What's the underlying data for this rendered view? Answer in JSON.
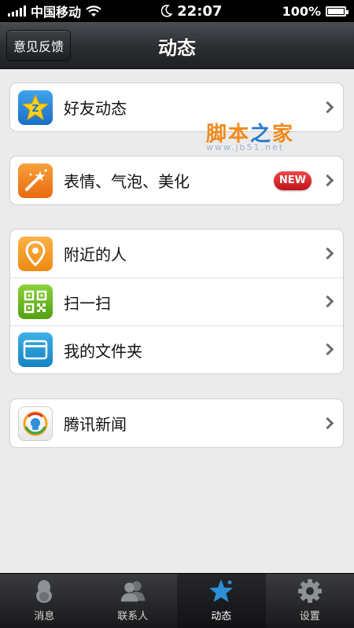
{
  "status_bar": {
    "carrier": "中国移动",
    "time": "22:07",
    "battery": "100%",
    "battery_level": 1.0
  },
  "nav": {
    "title": "动态",
    "feedback_button": "意见反馈"
  },
  "groups": [
    [
      {
        "label": "好友动态",
        "icon": "qzone-star-icon"
      }
    ],
    [
      {
        "label": "表情、气泡、美化",
        "icon": "magic-wand-icon",
        "badge": "NEW"
      }
    ],
    [
      {
        "label": "附近的人",
        "icon": "location-pin-icon"
      },
      {
        "label": "扫一扫",
        "icon": "qr-code-icon"
      },
      {
        "label": "我的文件夹",
        "icon": "folder-icon"
      }
    ],
    [
      {
        "label": "腾讯新闻",
        "icon": "tencent-news-icon"
      }
    ]
  ],
  "watermark": {
    "text_cn": "脚本之家",
    "url": "www.jb51.net"
  },
  "tabs": [
    {
      "label": "消息",
      "icon": "penguin-icon",
      "active": false
    },
    {
      "label": "联系人",
      "icon": "contacts-icon",
      "active": false
    },
    {
      "label": "动态",
      "icon": "star-icon",
      "active": true
    },
    {
      "label": "设置",
      "icon": "gear-icon",
      "active": false
    }
  ],
  "colors": {
    "accent_blue": "#2d8fd8",
    "badge_red": "#d8242c",
    "background": "#ebebeb"
  }
}
